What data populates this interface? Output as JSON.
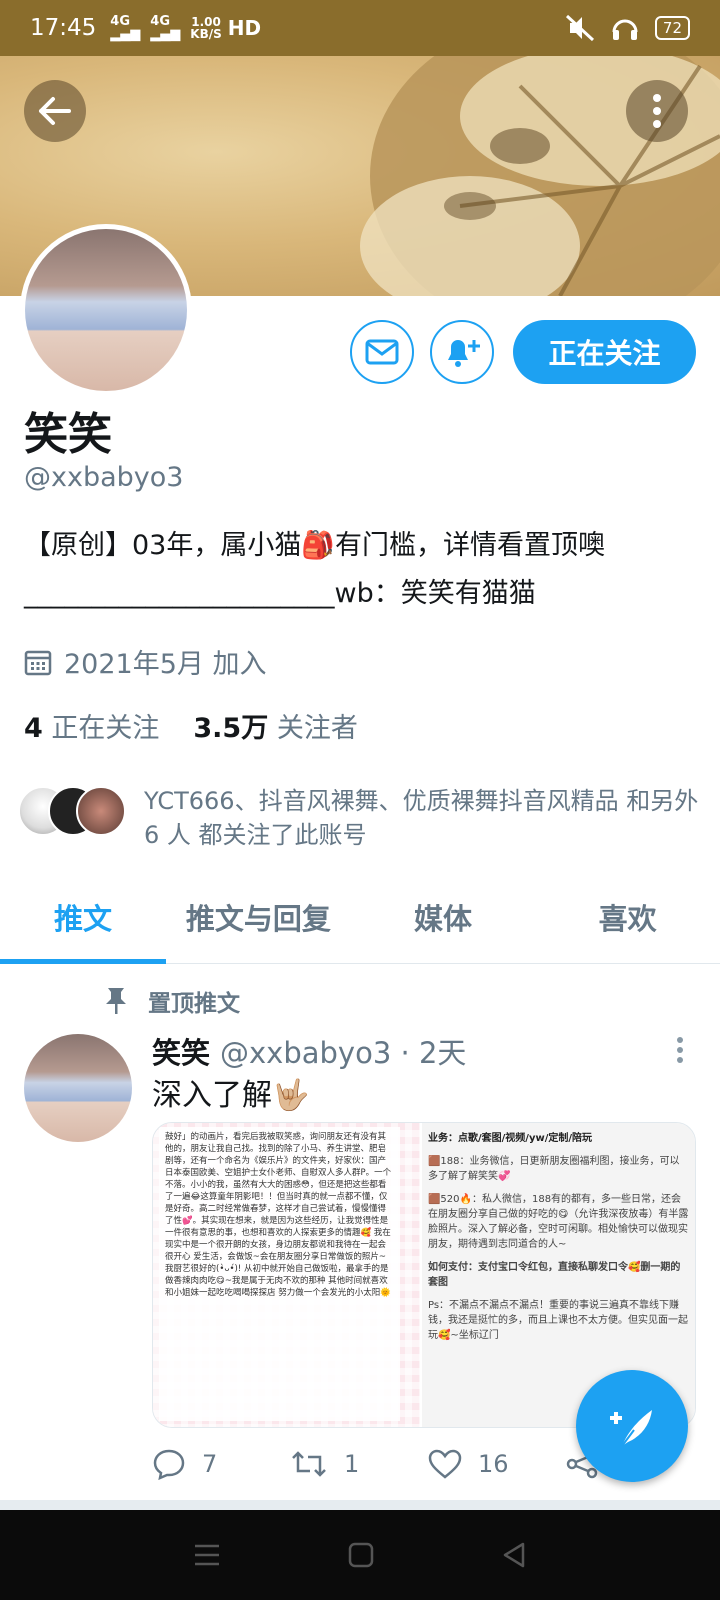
{
  "status_bar": {
    "time": "17:45",
    "net1": "4G",
    "net2": "4G",
    "speed_value": "1.00",
    "speed_unit": "KB/S",
    "hd": "HD",
    "battery": "72"
  },
  "profile": {
    "name": "笑笑",
    "handle": "@xxbabyo3",
    "follow_label": "正在关注",
    "bio_line1": "【原创】03年，属小猫🎒有门槛，详情看置顶噢",
    "bio_line2": "_______________________wb：笑笑有猫猫",
    "joined": "2021年5月 加入",
    "following_count": "4",
    "following_label": "正在关注",
    "followers_count": "3.5万",
    "followers_label": "关注者",
    "known_followers": "YCT666、抖音风裸舞、优质裸舞抖音风精品 和另外 6 人 都关注了此账号"
  },
  "tabs": [
    "推文",
    "推文与回复",
    "媒体",
    "喜欢"
  ],
  "tweet": {
    "pinned_label": "置顶推文",
    "author": "笑笑",
    "handle_time": "@xxbabyo3 · 2天",
    "text": "深入了解🤟🏼",
    "media_left_text": "鼓好」的动画片，看完后我被取笑惑，询问朋友还有没有其他的，朋友让我自己找。找到的除了小马、养生讲堂、肥皂剧等，还有一个命名为《娱乐片》的文件夹，好家伙：国产日本泰国欧美、空姐护士女仆老师、自慰双人多人群P。一个不落。小小的我，虽然有大大的困惑😳，但还是把这些都看了一遍😂这算童年阴影吧！！但当时真的就一点都不懂，仅是好奇。高二时经常做春梦，这样才自己尝试着，慢慢懂得了性💕。其实现在想来，就是因为这些经历，让我觉得性是一件很有意思的事，也想和喜欢的人探索更多的情趣🥰 我在现实中是一个很开朗的女孩，身边朋友都说和我待在一起会很开心 爱生活，会做饭~会在朋友圈分享日常做饭的照片~我厨艺很好的(•̀ᴗ•́)! 从初中就开始自己做饭啦，最拿手的是做香辣肉肉吃😋~我是属于无肉不欢的那种 其他时间就喜欢和小姐妹一起吃吃喝喝探探店 努力做一个会发光的小太阳🌞",
    "media_right_title": "业务：点歌/套图/视频/yw/定制/陪玩",
    "media_right_p1": "🟫188：业务微信，日更新朋友圈福利图，接业务，可以多了解了解笑笑💞",
    "media_right_p2": "🟫520🔥：私人微信，188有的都有，多一些日常，还会在朋友圈分享自己做的好吃的😋（允许我深夜放毒）有半露脸照片。深入了解必备，空时可闲聊。相处愉快可以做现实朋友，期待遇到志同道合的人~",
    "media_right_p3": "如何支付：支付宝口令红包，直接私聊发口令🥰删一期的套图",
    "media_right_p4": "Ps：不漏点不漏点不漏点！重要的事说三遍真不靠线下赚钱，我还是挺忙的多，而且上课也不太方便。但实见面一起玩🥰~坐标辽门",
    "replies": "7",
    "retweets": "1",
    "likes": "16"
  },
  "colors": {
    "accent": "#1da1f2",
    "status_bar": "#8a6d2c",
    "muted": "#657786"
  }
}
